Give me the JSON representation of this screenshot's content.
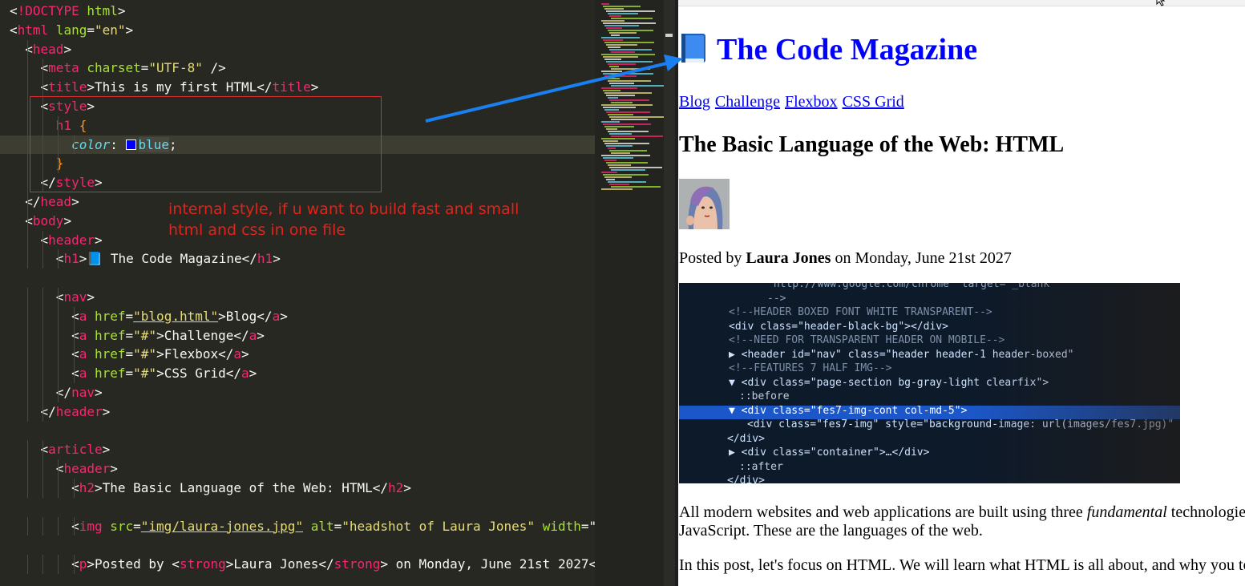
{
  "editor": {
    "lines": [
      [
        [
          "p",
          "<"
        ],
        [
          "t",
          "!DOCTYPE"
        ],
        [
          "a",
          " html"
        ],
        [
          "p",
          ">"
        ]
      ],
      [
        [
          "p",
          "<"
        ],
        [
          "t",
          "html"
        ],
        [
          "a",
          " lang"
        ],
        [
          "p",
          "="
        ],
        [
          "s",
          "\"en\""
        ],
        [
          "p",
          ">"
        ]
      ],
      [
        [
          "p",
          "  <"
        ],
        [
          "t",
          "head"
        ],
        [
          "p",
          ">"
        ]
      ],
      [
        [
          "p",
          "    <"
        ],
        [
          "t",
          "meta"
        ],
        [
          "a",
          " charset"
        ],
        [
          "p",
          "="
        ],
        [
          "s",
          "\"UTF-8\""
        ],
        [
          "p",
          " />"
        ]
      ],
      [
        [
          "p",
          "    <"
        ],
        [
          "t",
          "title"
        ],
        [
          "p",
          ">This is my first HTML</"
        ],
        [
          "t",
          "title"
        ],
        [
          "p",
          ">"
        ]
      ],
      [
        [
          "p",
          "    <"
        ],
        [
          "t",
          "style"
        ],
        [
          "p",
          ">"
        ]
      ],
      [
        [
          "t",
          "      h1 "
        ],
        [
          "b",
          "{"
        ]
      ],
      [
        [
          "c",
          "        color"
        ],
        [
          "p",
          ": "
        ],
        [
          "SW",
          ""
        ],
        [
          "SEL",
          "blue"
        ],
        [
          "p",
          ";"
        ]
      ],
      [
        [
          "b",
          "      }"
        ]
      ],
      [
        [
          "p",
          "    </"
        ],
        [
          "t",
          "style"
        ],
        [
          "p",
          ">"
        ]
      ],
      [
        [
          "p",
          "  </"
        ],
        [
          "t",
          "head"
        ],
        [
          "p",
          ">"
        ]
      ],
      [
        [
          "p",
          "  <"
        ],
        [
          "t",
          "body"
        ],
        [
          "p",
          ">"
        ]
      ],
      [
        [
          "p",
          "    <"
        ],
        [
          "t",
          "header"
        ],
        [
          "p",
          ">"
        ]
      ],
      [
        [
          "p",
          "      <"
        ],
        [
          "t",
          "h1"
        ],
        [
          "p",
          ">📘 The Code Magazine</"
        ],
        [
          "t",
          "h1"
        ],
        [
          "p",
          ">"
        ]
      ],
      [
        [
          "p",
          ""
        ]
      ],
      [
        [
          "p",
          "      <"
        ],
        [
          "t",
          "nav"
        ],
        [
          "p",
          ">"
        ]
      ],
      [
        [
          "p",
          "        <"
        ],
        [
          "t",
          "a"
        ],
        [
          "a",
          " href"
        ],
        [
          "p",
          "="
        ],
        [
          "U",
          "\"blog.html\""
        ],
        [
          "p",
          ">Blog</"
        ],
        [
          "t",
          "a"
        ],
        [
          "p",
          ">"
        ]
      ],
      [
        [
          "p",
          "        <"
        ],
        [
          "t",
          "a"
        ],
        [
          "a",
          " href"
        ],
        [
          "p",
          "="
        ],
        [
          "s",
          "\"#\""
        ],
        [
          "p",
          ">Challenge</"
        ],
        [
          "t",
          "a"
        ],
        [
          "p",
          ">"
        ]
      ],
      [
        [
          "p",
          "        <"
        ],
        [
          "t",
          "a"
        ],
        [
          "a",
          " href"
        ],
        [
          "p",
          "="
        ],
        [
          "s",
          "\"#\""
        ],
        [
          "p",
          ">Flexbox</"
        ],
        [
          "t",
          "a"
        ],
        [
          "p",
          ">"
        ]
      ],
      [
        [
          "p",
          "        <"
        ],
        [
          "t",
          "a"
        ],
        [
          "a",
          " href"
        ],
        [
          "p",
          "="
        ],
        [
          "s",
          "\"#\""
        ],
        [
          "p",
          ">CSS Grid</"
        ],
        [
          "t",
          "a"
        ],
        [
          "p",
          ">"
        ]
      ],
      [
        [
          "p",
          "      </"
        ],
        [
          "t",
          "nav"
        ],
        [
          "p",
          ">"
        ]
      ],
      [
        [
          "p",
          "    </"
        ],
        [
          "t",
          "header"
        ],
        [
          "p",
          ">"
        ]
      ],
      [
        [
          "p",
          ""
        ]
      ],
      [
        [
          "p",
          "    <"
        ],
        [
          "t",
          "article"
        ],
        [
          "p",
          ">"
        ]
      ],
      [
        [
          "p",
          "      <"
        ],
        [
          "t",
          "header"
        ],
        [
          "p",
          ">"
        ]
      ],
      [
        [
          "p",
          "        <"
        ],
        [
          "t",
          "h2"
        ],
        [
          "p",
          ">The Basic Language of the Web: HTML</"
        ],
        [
          "t",
          "h2"
        ],
        [
          "p",
          ">"
        ]
      ],
      [
        [
          "p",
          ""
        ]
      ],
      [
        [
          "p",
          "        <"
        ],
        [
          "t",
          "img"
        ],
        [
          "a",
          " src"
        ],
        [
          "p",
          "="
        ],
        [
          "U",
          "\"img/laura-jones.jpg\""
        ],
        [
          "a",
          " alt"
        ],
        [
          "p",
          "="
        ],
        [
          "s",
          "\"headshot of Laura Jones\""
        ],
        [
          "a",
          " width"
        ],
        [
          "p",
          "=\""
        ]
      ],
      [
        [
          "p",
          ""
        ]
      ],
      [
        [
          "p",
          "        <"
        ],
        [
          "t",
          "p"
        ],
        [
          "p",
          ">Posted by <"
        ],
        [
          "t",
          "strong"
        ],
        [
          "p",
          ">Laura Jones</"
        ],
        [
          "t",
          "strong"
        ],
        [
          "p",
          "> on Monday, June 21st 2027<"
        ]
      ]
    ],
    "annotation": "internal style, if u want to build fast and small html and css in one file"
  },
  "browser": {
    "site_title": "The Code Magazine",
    "nav": [
      "Blog",
      "Challenge",
      "Flexbox",
      "CSS Grid"
    ],
    "article_title": "The Basic Language of the Web: HTML",
    "byline_prefix": "Posted by ",
    "byline_author": "Laura Jones",
    "byline_suffix": " on Monday, June 21st 2027",
    "hero_code": [
      "\"http://www.google.com/chrome\" target=\"_blank\"",
      "-->",
      "<!--HEADER BOXED FONT WHITE TRANSPARENT-->",
      "<div class=\"header-black-bg\"></div>",
      "<!--NEED FOR TRANSPARENT HEADER ON MOBILE-->",
      "▶ <header id=\"nav\" class=\"header header-1 header-boxed\"",
      "<!--FEATURES 7 HALF IMG-->",
      "▼ <div class=\"page-section bg-gray-light clearfix\">",
      "  ::before",
      "▼ <div class=\"fes7-img-cont col-md-5\">",
      "    <div class=\"fes7-img\" style=\"background-image: url(images/fes7.jpg)\"",
      "  </div>",
      "▶ <div class=\"container\">…</div>",
      "  ::after",
      "</div>"
    ],
    "para1_a": "All modern websites and web applications are built using three ",
    "para1_em": "fundamental",
    "para1_b": " technologies: HTML, CSS and",
    "para1_line2": "JavaScript. These are the languages of the web.",
    "para2": "In this post, let's focus on HTML. We will learn what HTML is all about, and why you too should learn it."
  },
  "colors": {
    "editor_bg": "#272822",
    "title_blue": "#0000ff",
    "annotation_red": "#e0241b",
    "arrow_blue": "#1a7ff0"
  }
}
